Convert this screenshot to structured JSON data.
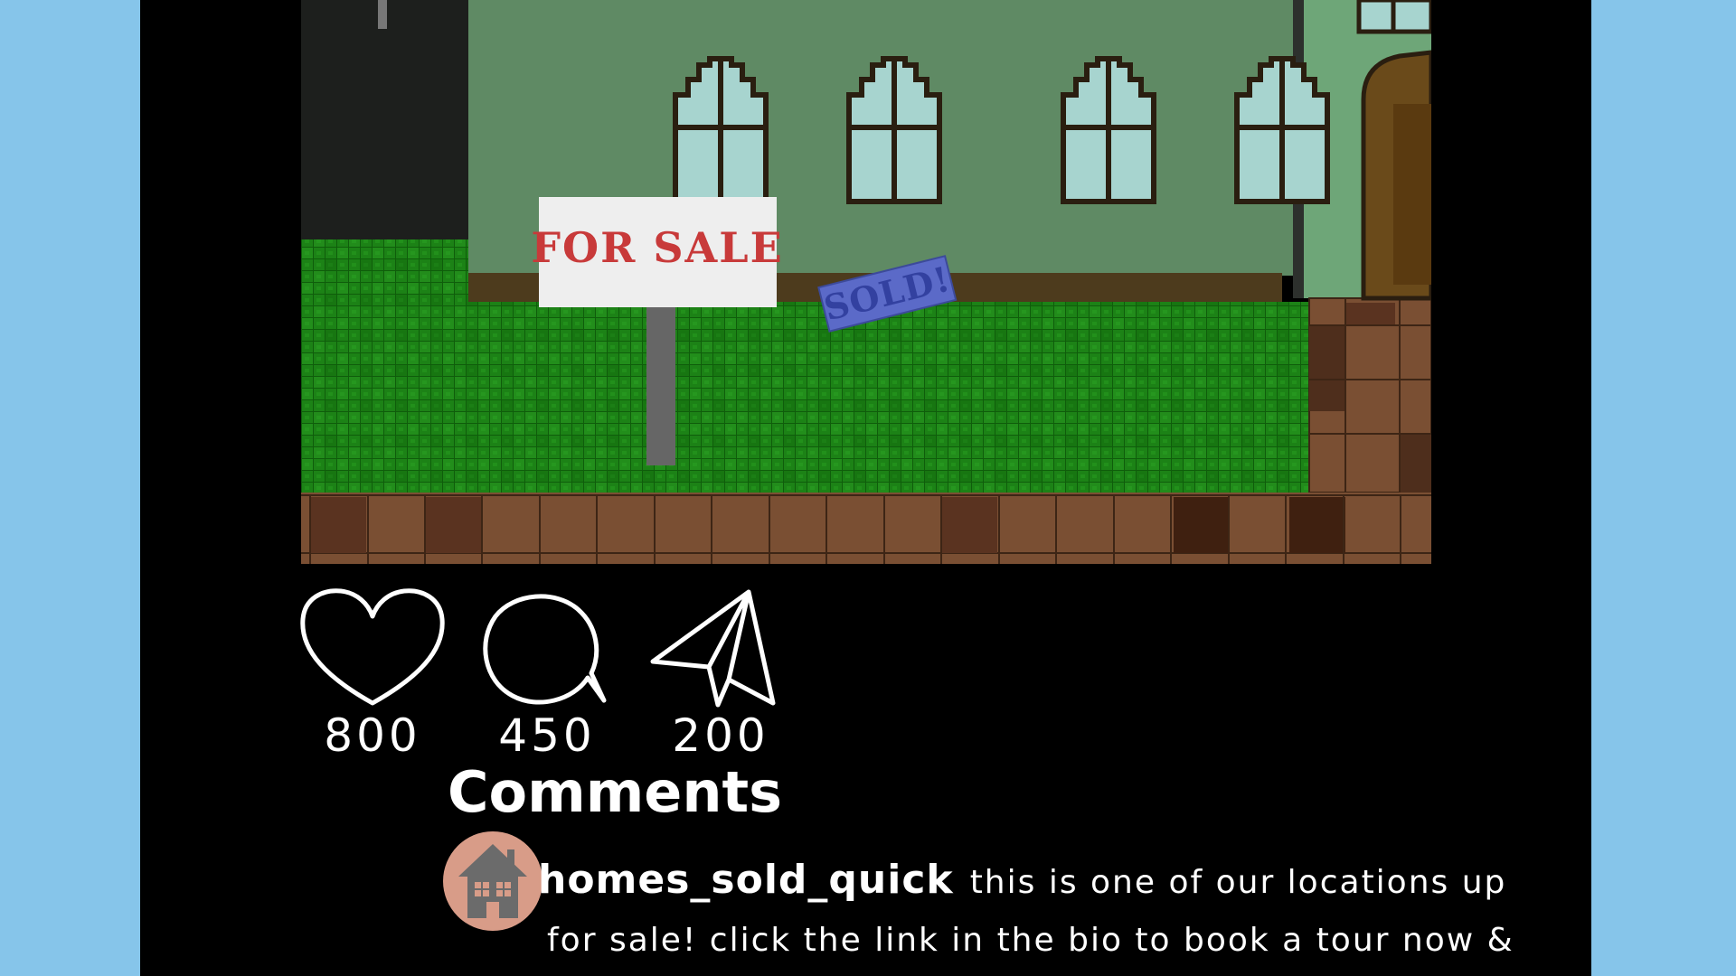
{
  "post": {
    "sign_text": "FOR SALE",
    "sold_text": "SOLD!"
  },
  "actions": {
    "likes": "800",
    "comments": "450",
    "shares": "200"
  },
  "comments_section": {
    "heading": "Comments",
    "items": [
      {
        "username": "homes_sold_quick",
        "text": "this is one of our locations up for sale! click the link in the bio to book a tour now &"
      }
    ]
  },
  "colors": {
    "background": "#86c5ea",
    "phone": "#000000",
    "avatar": "#d89c88",
    "grass": "#1b7e12",
    "house": "#5f8a64",
    "sign_red": "#c83a3a",
    "sold_blue": "#5b6ac8"
  },
  "icons": [
    "heart-icon",
    "comment-bubble-icon",
    "paper-plane-icon",
    "house-icon"
  ]
}
